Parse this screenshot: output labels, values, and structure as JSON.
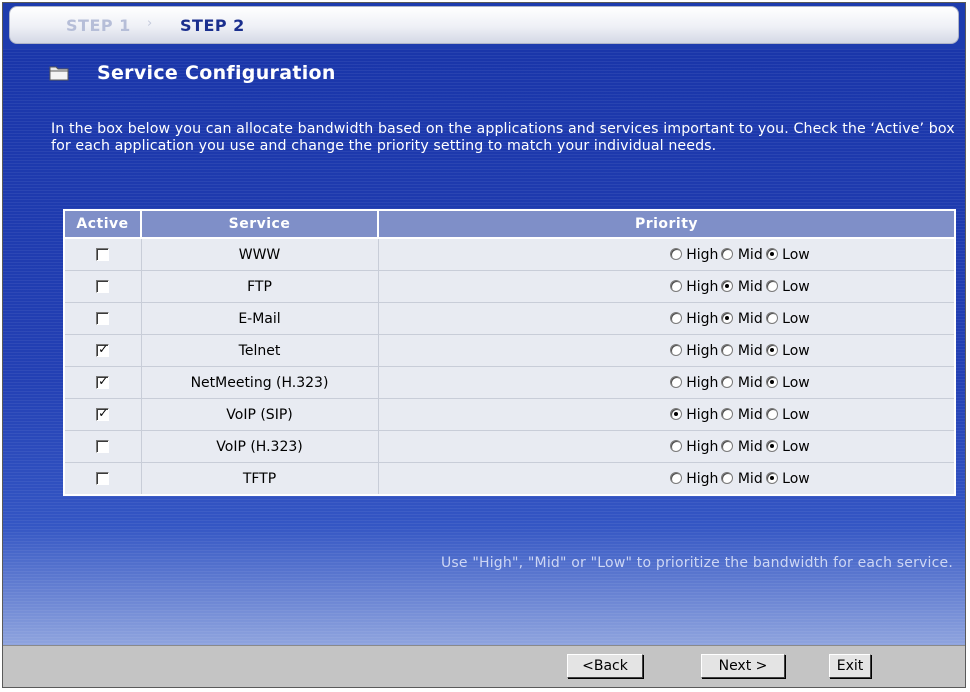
{
  "steps": {
    "step1": "STEP 1",
    "separator": "›",
    "step2": "STEP 2"
  },
  "section": {
    "icon": "folder-icon",
    "title": "Service Configuration"
  },
  "description": "In the box below you can allocate bandwidth based on the applications and services important to you. Check the ‘Active’ box for each application you use and change the priority setting to match your individual needs.",
  "table": {
    "headers": {
      "active": "Active",
      "service": "Service",
      "priority": "Priority"
    },
    "priority_labels": {
      "high": "High",
      "mid": "Mid",
      "low": "Low"
    },
    "rows": [
      {
        "service": "WWW",
        "active": false,
        "priority": "Low"
      },
      {
        "service": "FTP",
        "active": false,
        "priority": "Mid"
      },
      {
        "service": "E-Mail",
        "active": false,
        "priority": "Mid"
      },
      {
        "service": "Telnet",
        "active": true,
        "priority": "Low"
      },
      {
        "service": "NetMeeting (H.323)",
        "active": true,
        "priority": "Low"
      },
      {
        "service": "VoIP (SIP)",
        "active": true,
        "priority": "High"
      },
      {
        "service": "VoIP (H.323)",
        "active": false,
        "priority": "Low"
      },
      {
        "service": "TFTP",
        "active": false,
        "priority": "Low"
      }
    ]
  },
  "hint": "Use \"High\", \"Mid\" or \"Low\" to prioritize the bandwidth for each service.",
  "buttons": {
    "back": "<Back",
    "next": "Next >",
    "exit": "Exit"
  },
  "colors": {
    "body_blue": "#2a47b6",
    "header_blue": "#7f8fc8",
    "step_active": "#1b2f8e"
  }
}
